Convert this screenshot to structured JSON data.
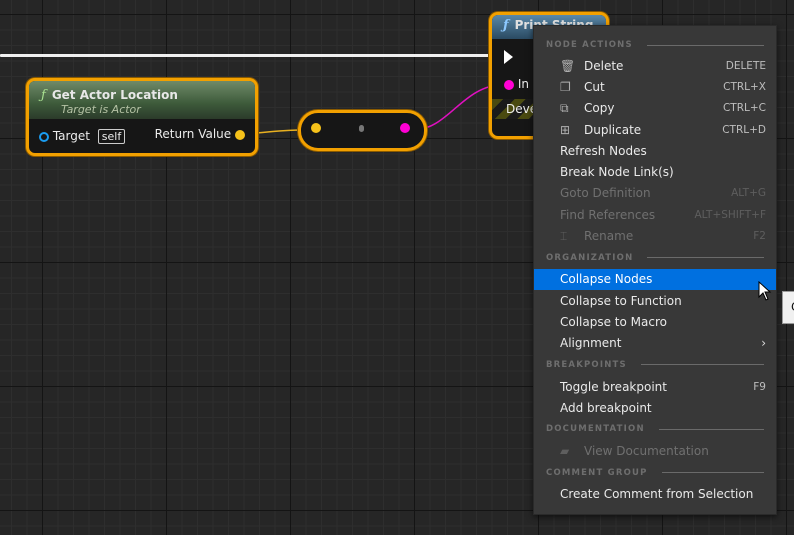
{
  "graph": {
    "get_actor_location": {
      "title": "Get Actor Location",
      "subtitle": "Target is Actor",
      "target_label": "Target",
      "target_default": "self",
      "return_label": "Return Value",
      "function_glyph": "ƒ"
    },
    "print_string": {
      "title": "Print String",
      "in_label": "In String",
      "dev_label": "Development Only",
      "function_glyph": "ƒ"
    },
    "colors": {
      "selection": "#f2a000",
      "vector_pin": "#f6c21a",
      "string_pin": "#ff00d4",
      "object_pin": "#1a9cf0",
      "exec": "#ffffff"
    }
  },
  "menu": {
    "sections": [
      {
        "header": "NODE ACTIONS",
        "items": [
          {
            "label": "Delete",
            "shortcut": "DELETE",
            "icon": "trash-icon",
            "enabled": true
          },
          {
            "label": "Cut",
            "shortcut": "CTRL+X",
            "icon": "cut-icon",
            "enabled": true
          },
          {
            "label": "Copy",
            "shortcut": "CTRL+C",
            "icon": "copy-icon",
            "enabled": true
          },
          {
            "label": "Duplicate",
            "shortcut": "CTRL+D",
            "icon": "duplicate-icon",
            "enabled": true
          },
          {
            "label": "Refresh Nodes",
            "shortcut": "",
            "enabled": true
          },
          {
            "label": "Break Node Link(s)",
            "shortcut": "",
            "enabled": true
          },
          {
            "label": "Goto Definition",
            "shortcut": "ALT+G",
            "enabled": false
          },
          {
            "label": "Find References",
            "shortcut": "ALT+SHIFT+F",
            "enabled": false
          },
          {
            "label": "Rename",
            "shortcut": "F2",
            "icon": "rename-icon",
            "enabled": false
          }
        ]
      },
      {
        "header": "ORGANIZATION",
        "items": [
          {
            "label": "Collapse Nodes",
            "shortcut": "",
            "enabled": true,
            "highlighted": true
          },
          {
            "label": "Collapse to Function",
            "shortcut": "",
            "enabled": true
          },
          {
            "label": "Collapse to Macro",
            "shortcut": "",
            "enabled": true
          },
          {
            "label": "Alignment",
            "shortcut": "",
            "enabled": true,
            "submenu": true
          }
        ]
      },
      {
        "header": "BREAKPOINTS",
        "items": [
          {
            "label": "Toggle breakpoint",
            "shortcut": "F9",
            "enabled": true
          },
          {
            "label": "Add breakpoint",
            "shortcut": "",
            "enabled": true
          }
        ]
      },
      {
        "header": "DOCUMENTATION",
        "items": [
          {
            "label": "View Documentation",
            "shortcut": "",
            "icon": "book-icon",
            "enabled": false
          }
        ]
      },
      {
        "header": "COMMENT GROUP",
        "items": [
          {
            "label": "Create Comment from Selection",
            "shortcut": "",
            "enabled": true
          }
        ]
      }
    ],
    "highlight_color": "#0070e0"
  },
  "tooltip": {
    "text": "C"
  }
}
